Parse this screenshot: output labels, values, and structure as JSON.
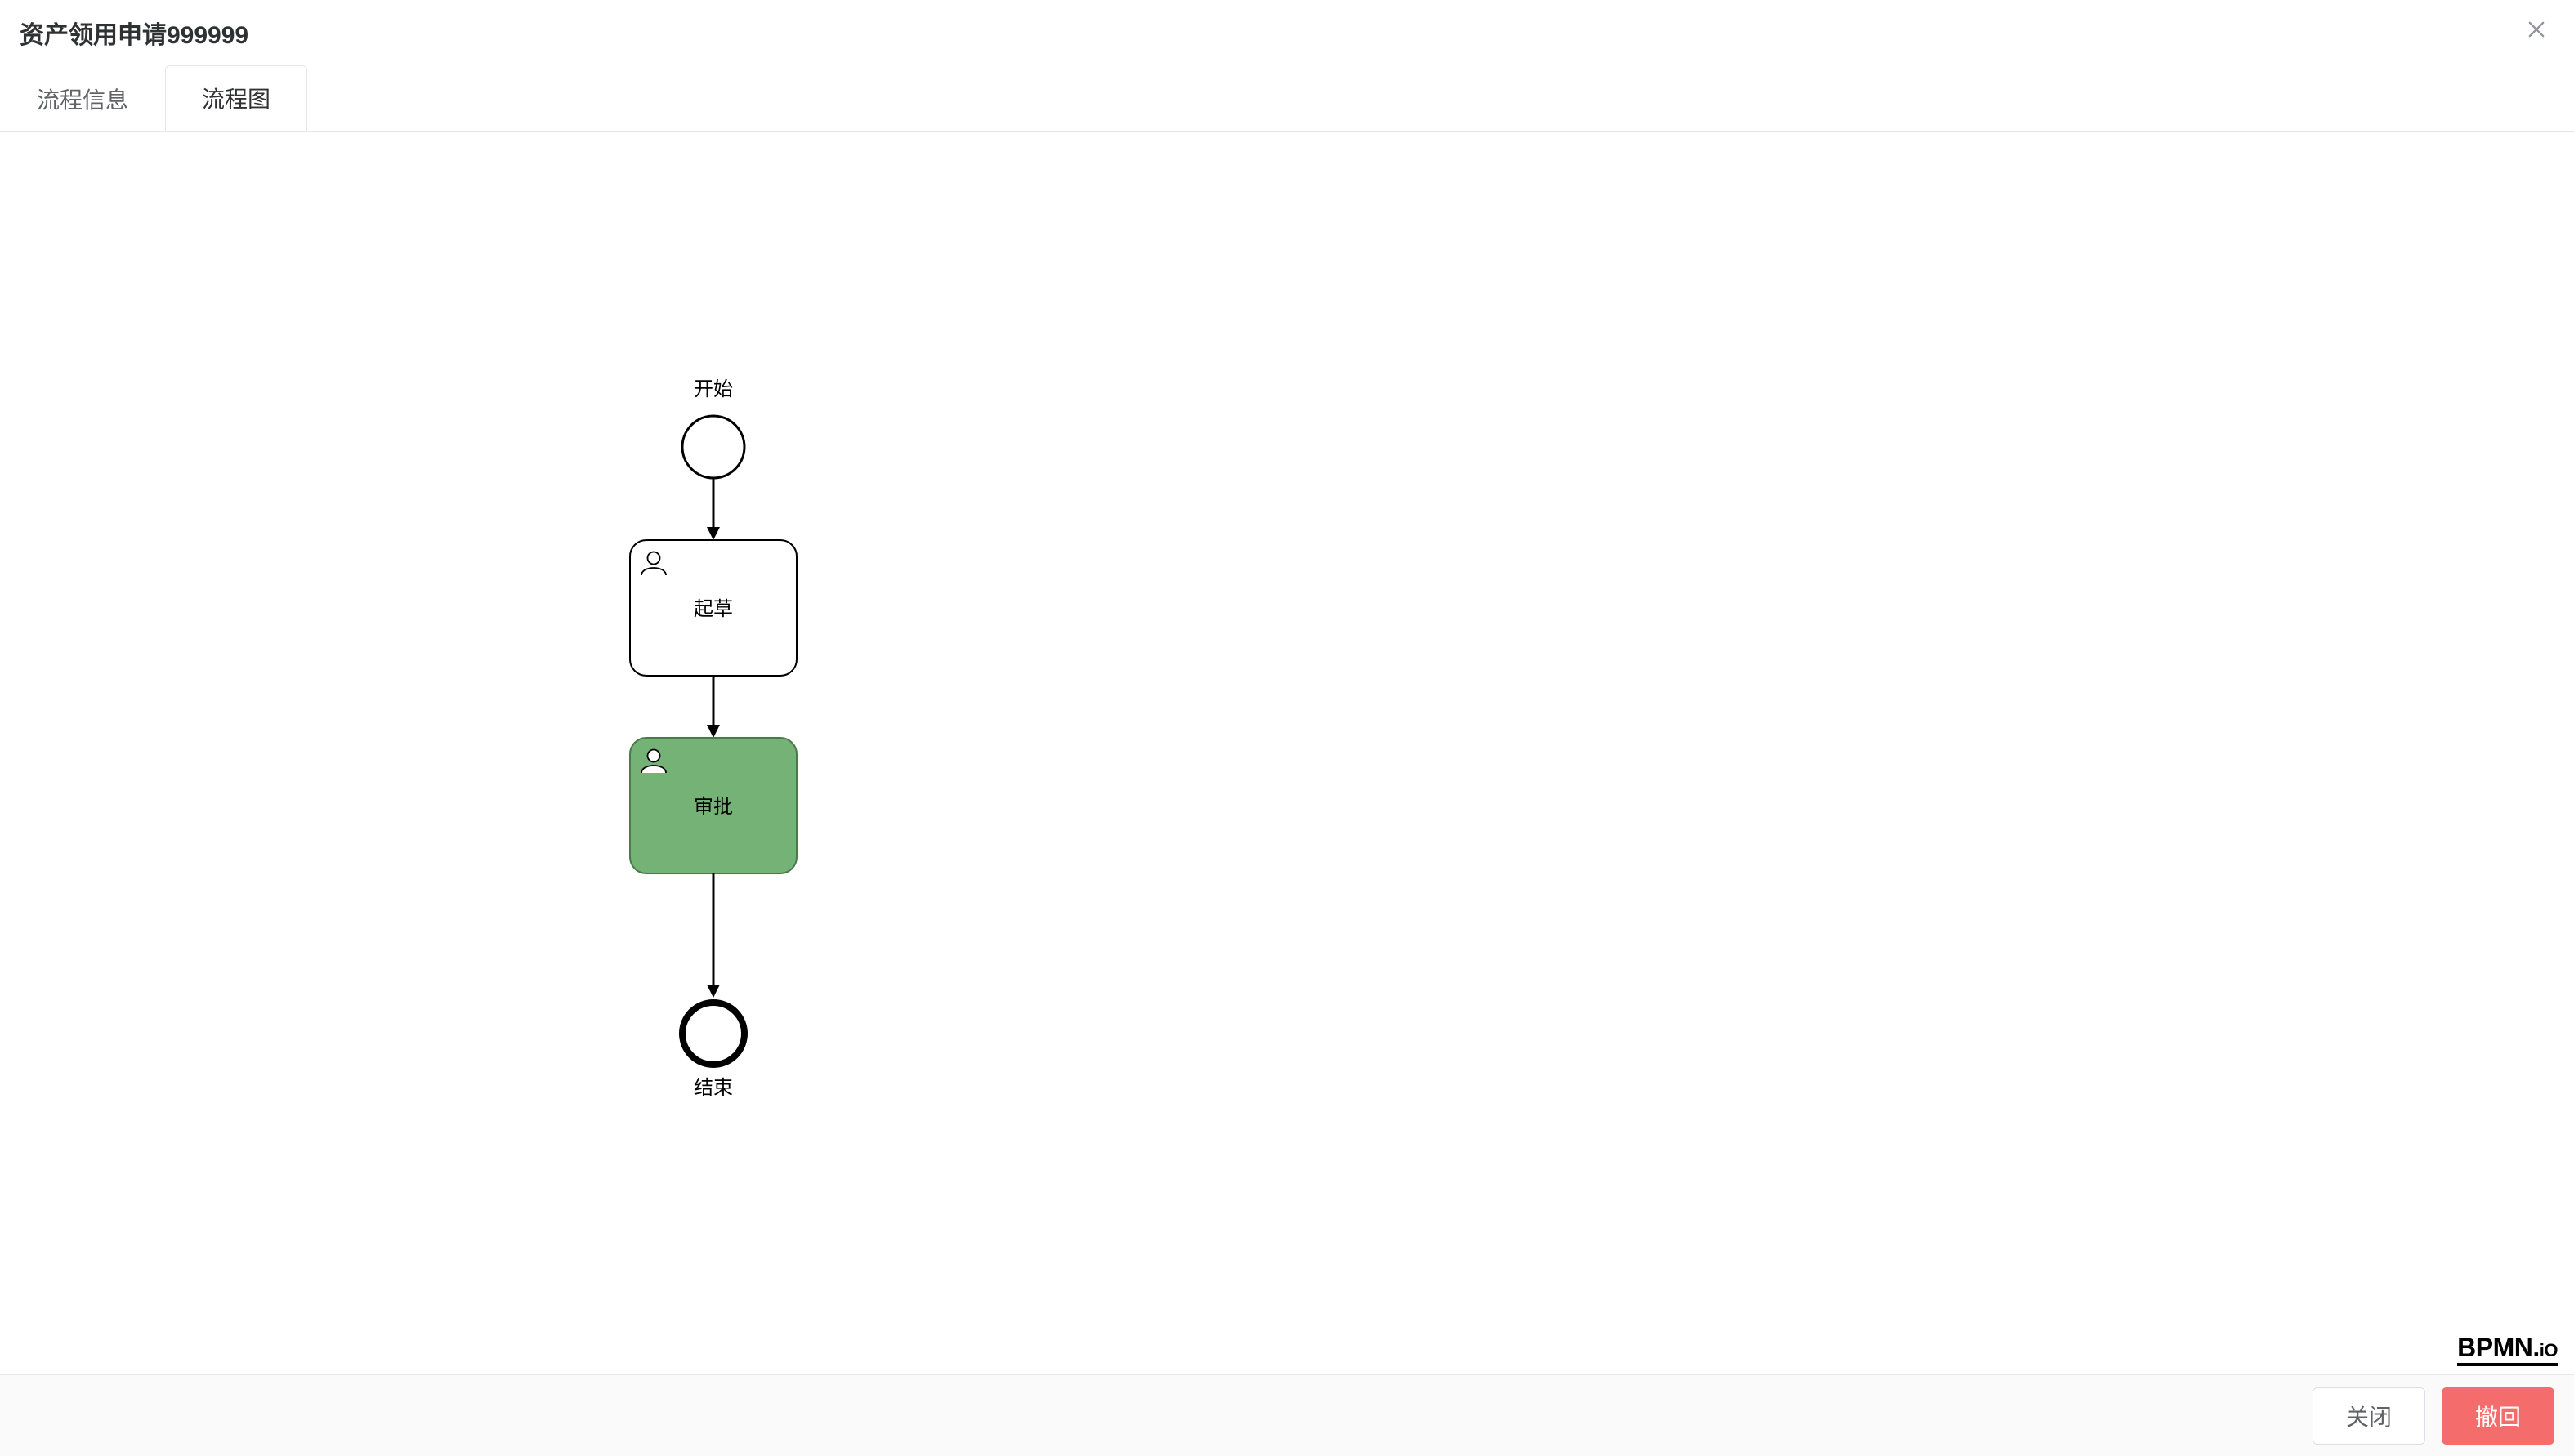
{
  "dialog": {
    "title": "资产领用申请999999"
  },
  "tabs": [
    {
      "label": "流程信息",
      "active": false
    },
    {
      "label": "流程图",
      "active": true
    }
  ],
  "diagram": {
    "start_label": "开始",
    "end_label": "结束",
    "nodes": [
      {
        "id": "draft",
        "label": "起草",
        "highlighted": false
      },
      {
        "id": "approve",
        "label": "审批",
        "highlighted": true
      }
    ],
    "watermark": "BPMN.iO"
  },
  "footer": {
    "close_label": "关闭",
    "withdraw_label": "撤回"
  }
}
